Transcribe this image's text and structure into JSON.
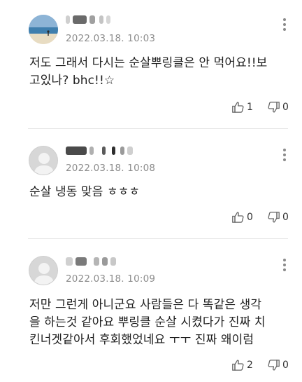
{
  "comments": [
    {
      "date": "2022.03.18. 10:03",
      "text_line1": "저도 그래서 다시는 순살뿌링클은 안 먹어요!!보",
      "text_line2": "고있나? bhc!!☆",
      "likes": "1",
      "dislikes": "0",
      "avatar": "photo"
    },
    {
      "date": "2022.03.18. 10:08",
      "text_line1": "순살 냉동 맞음 ㅎㅎㅎ",
      "likes": "0",
      "dislikes": "0",
      "avatar": "default"
    },
    {
      "date": "2022.03.18. 10:09",
      "text_line1": "저만 그런게 아니군요 사람들은 다 똑같은 생각",
      "text_line2": "을 하는것 같아요 뿌링클 순살 시켰다가 진짜 치",
      "text_line3": "킨너겟같아서 후회했었네요 ㅜㅜ 진짜 왜이럼",
      "likes": "2",
      "dislikes": "0",
      "avatar": "default"
    }
  ],
  "icons": {
    "like": "thumbs-up-icon",
    "dislike": "thumbs-down-icon",
    "more": "more-vertical-icon",
    "avatar_default": "default-avatar-icon"
  },
  "colors": {
    "date": "#8c8c8c",
    "icon": "#8a8a8a",
    "separator": "#e6e6e6"
  }
}
